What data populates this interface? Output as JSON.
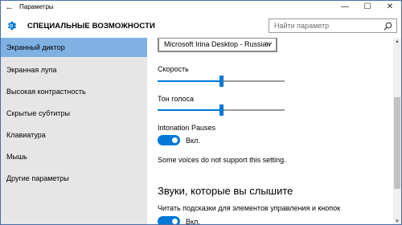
{
  "window": {
    "title": "Параметры",
    "back_icon": "back-arrow-icon",
    "controls": {
      "minimize": "—",
      "maximize": "☐",
      "close": "✕"
    }
  },
  "header": {
    "icon": "gear-icon",
    "section_title": "СПЕЦИАЛЬНЫЕ ВОЗМОЖНОСТИ",
    "search_placeholder": "Найти параметр"
  },
  "sidebar": {
    "items": [
      {
        "label": "Экранный диктор",
        "active": true
      },
      {
        "label": "Экранная лупа",
        "active": false
      },
      {
        "label": "Высокая контрастность",
        "active": false
      },
      {
        "label": "Скрытые субтитры",
        "active": false
      },
      {
        "label": "Клавиатура",
        "active": false
      },
      {
        "label": "Мышь",
        "active": false
      },
      {
        "label": "Другие параметры",
        "active": false
      }
    ]
  },
  "content": {
    "voice_select": "Microsoft Irina Desktop - Russian",
    "speed": {
      "label": "Скорость",
      "value_fraction": 0.5
    },
    "pitch": {
      "label": "Тон голоса",
      "value_fraction": 0.5
    },
    "intonation": {
      "label": "Intonation Pauses",
      "state": "Вкл."
    },
    "note": "Some voices do not support this setting.",
    "sounds_heading": "Звуки, которые вы слышите",
    "hints": {
      "label": "Читать подсказки для элементов управления и кнопок",
      "state": "Вкл."
    }
  },
  "colors": {
    "accent": "#0078d7",
    "active_nav": "#7fb1e3",
    "sidebar_bg": "#e6e6e6"
  }
}
